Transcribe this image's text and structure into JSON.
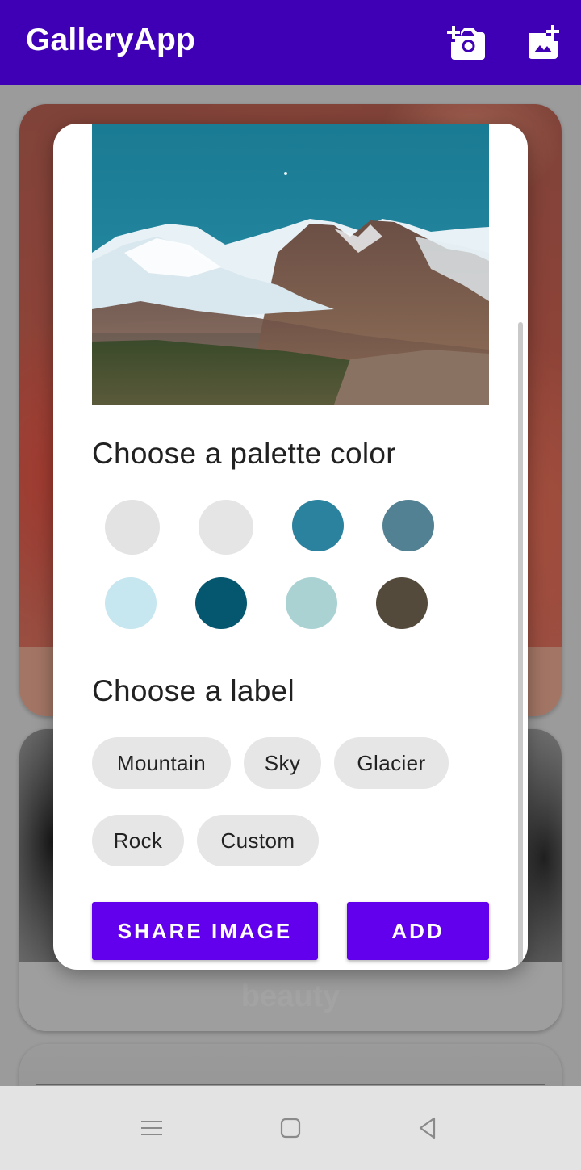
{
  "app_bar": {
    "title": "GalleryApp",
    "actions": [
      {
        "icon": "add-camera-icon"
      },
      {
        "icon": "add-photo-icon"
      }
    ],
    "color": "#3f00b5"
  },
  "gallery": {
    "cards": [
      {
        "caption": ""
      },
      {
        "caption": "beauty"
      },
      {
        "caption": ""
      }
    ]
  },
  "dialog": {
    "palette_title": "Choose a palette color",
    "palette_colors": [
      "#e3e3e3",
      "#e5e5e5",
      "#2a829f",
      "#528194",
      "#c6e6f0",
      "#055770",
      "#aad2d3",
      "#544a3b"
    ],
    "label_title": "Choose a label",
    "labels": [
      "Mountain",
      "Sky",
      "Glacier",
      "Rock",
      "Custom"
    ],
    "share_button": "SHARE IMAGE",
    "add_button": "ADD",
    "accent": "#6200ee"
  },
  "nav_bar": {
    "buttons": [
      {
        "icon": "menu-icon"
      },
      {
        "icon": "home-icon"
      },
      {
        "icon": "back-icon"
      }
    ]
  }
}
